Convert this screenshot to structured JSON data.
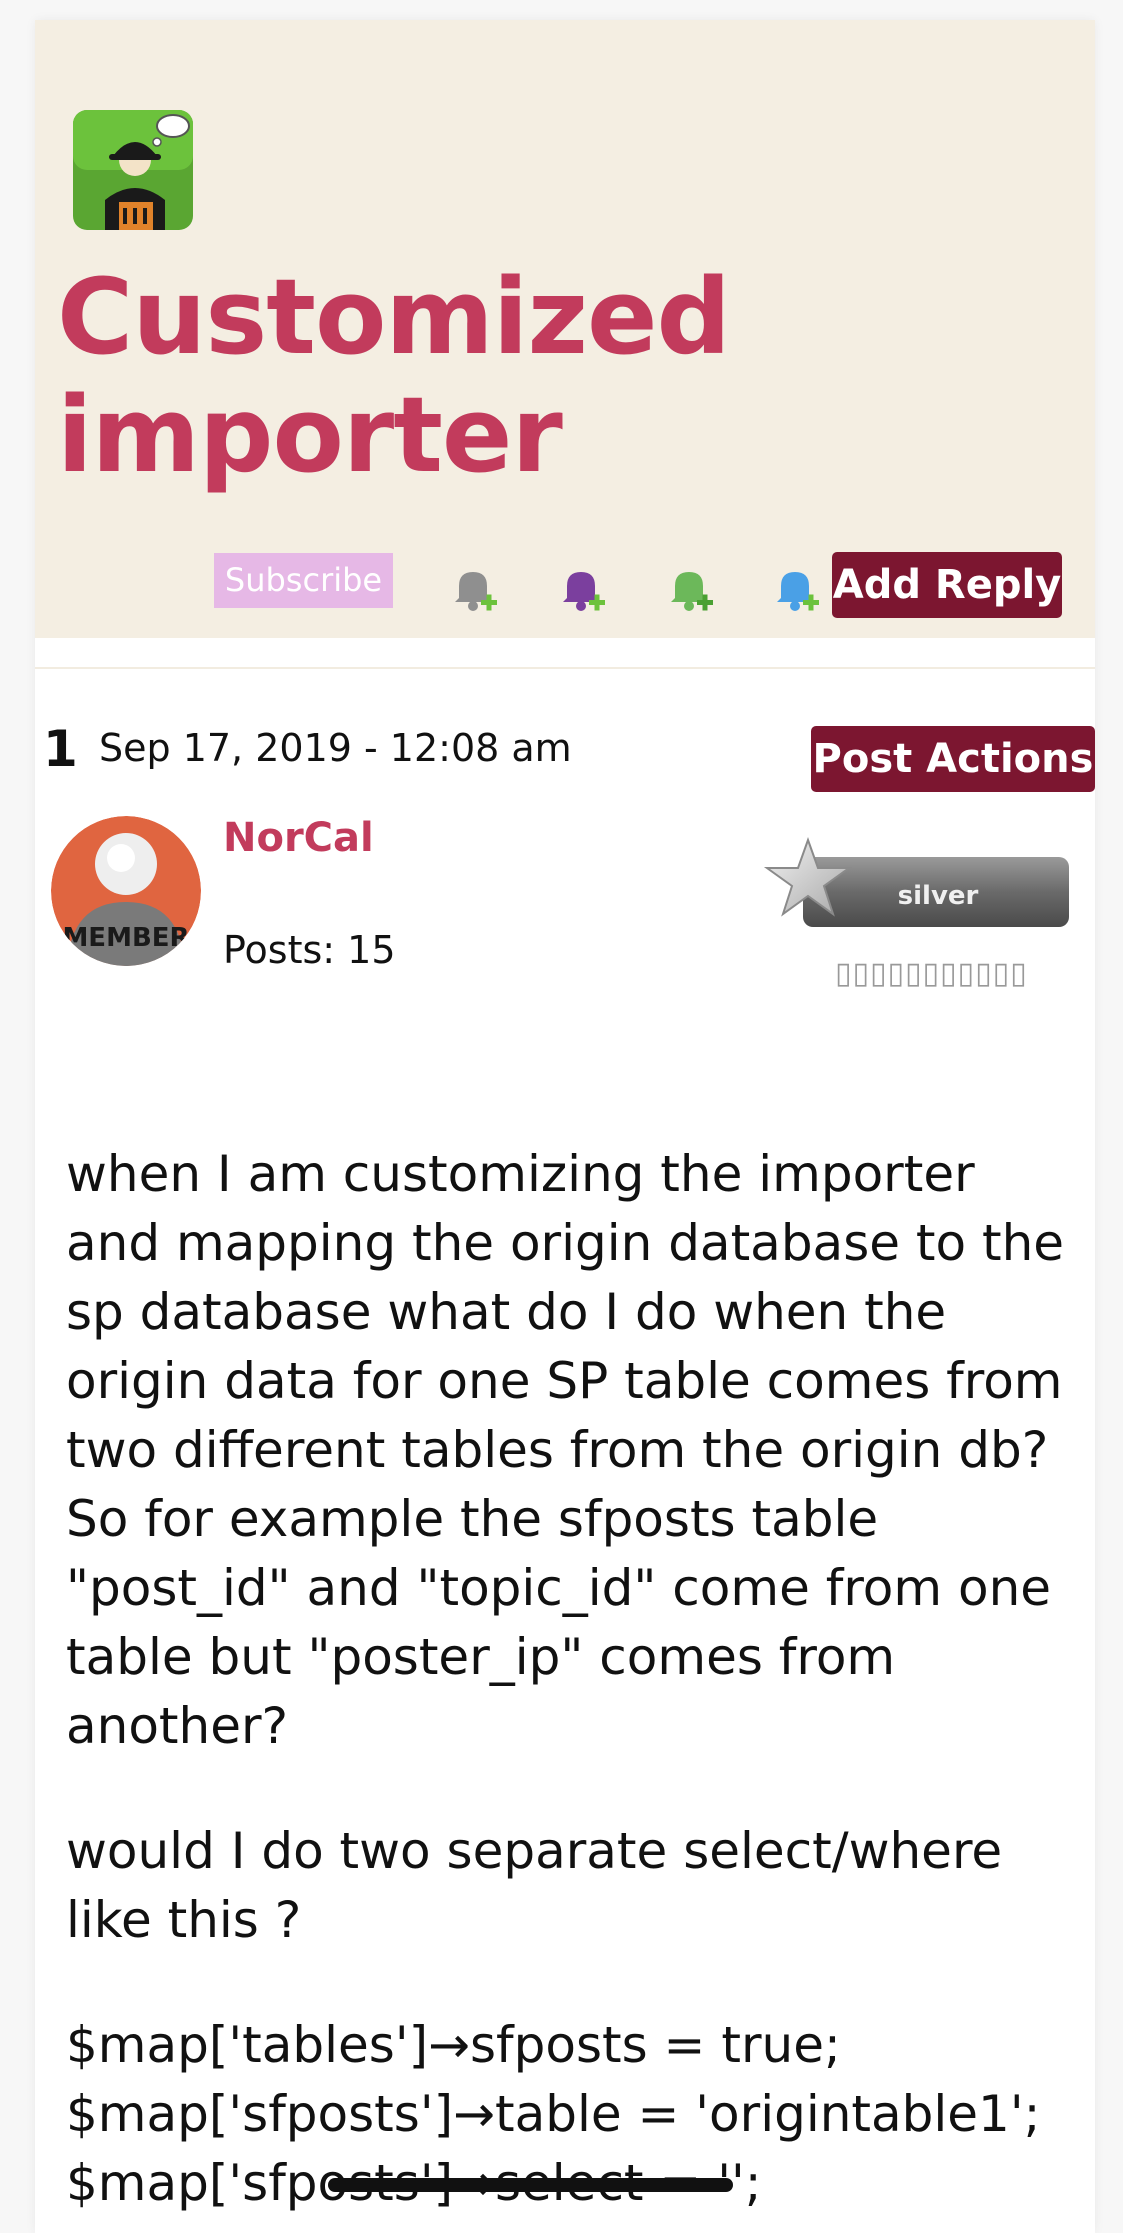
{
  "topic": {
    "title": "Customized importer",
    "subscribe_label": "Subscribe",
    "add_reply_label": "Add Reply"
  },
  "post": {
    "number": "1",
    "date": "Sep 17, 2019 - 12:08 am",
    "actions_label": "Post Actions",
    "author": "NorCal",
    "posts_count": "Posts: 15",
    "avatar_text": "MEMBER",
    "badge_label": "silver",
    "rank_text": "▯▯▯▯▯▯▯▯▯▯▯",
    "paragraphs": [
      "when I am customizing the importer and mapping the origin database to the sp database what do I do when the origin data for one SP table comes from two different tables from the origin db?  So for example the sfposts table \"post_id\" and \"topic_id\" come from one table but \"poster_ip\" comes from another?",
      "would I do two separate select/where like this ?"
    ],
    "code_lines": [
      "$map['tables']→sfposts = true;",
      "$map['sfposts']→table = 'origintable1';",
      "$map['sfposts']→select = '';"
    ]
  },
  "colors": {
    "accent": "#c23b5c",
    "button_bg": "#7c1630",
    "header_bg": "#f4eee2",
    "subscribe_bg": "#e6b8e6"
  },
  "icons": [
    "forum-logo-icon",
    "bell-add-icon-gray",
    "bell-add-icon-purple",
    "bell-add-icon-green",
    "bell-add-icon-blue",
    "member-avatar-icon",
    "silver-star-badge-icon"
  ]
}
